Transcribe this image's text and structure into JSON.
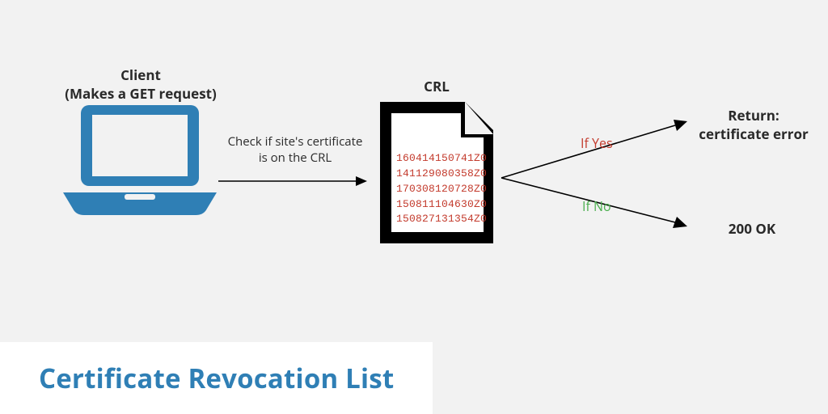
{
  "client": {
    "title_line1": "Client",
    "title_line2": "(Makes a GET request)"
  },
  "arrow_check_caption_line1": "Check if site's certificate",
  "arrow_check_caption_line2": "is on the CRL",
  "crl": {
    "title": "CRL",
    "entries": [
      "160414150741Z0",
      "141129080358Z0",
      "170308120728Z0",
      "150811104630Z0",
      "150827131354Z0"
    ]
  },
  "branch_yes": "If Yes",
  "branch_no": "If No",
  "result_error_line1": "Return:",
  "result_error_line2": "certificate error",
  "result_ok": "200 OK",
  "page_title": "Certificate Revocation List",
  "colors": {
    "accent_blue": "#2f7fb5",
    "danger_red": "#c33a2c",
    "ok_green": "#4caf50"
  }
}
